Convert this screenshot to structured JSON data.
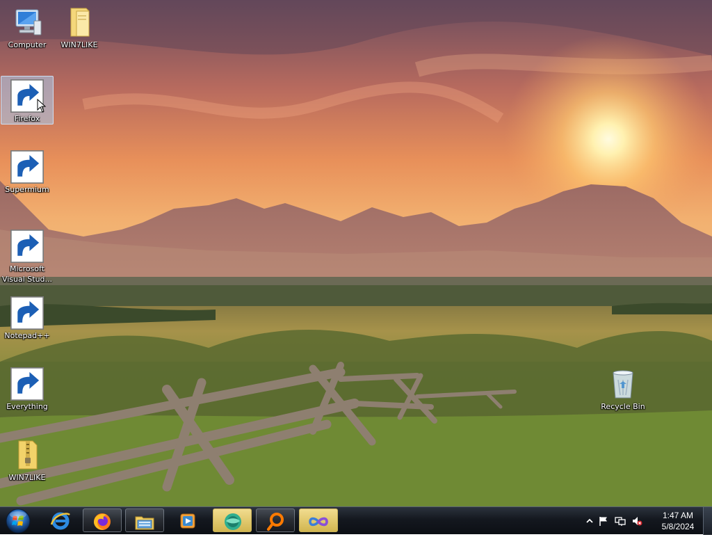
{
  "desktop": {
    "icons": [
      {
        "name": "computer",
        "label": "Computer",
        "icon": "computer-icon",
        "shortcut": false
      },
      {
        "name": "win7like-folder-top",
        "label": "WIN7LIKE",
        "icon": "folder-icon",
        "shortcut": false
      },
      {
        "name": "firefox",
        "label": "Firefox",
        "icon": "firefox-icon",
        "shortcut": true,
        "selected": true
      },
      {
        "name": "supermium",
        "label": "Supermium",
        "icon": "supermium-icon",
        "shortcut": true
      },
      {
        "name": "visual-studio",
        "label": "Microsoft\nVisual Stud...",
        "icon": "visual-studio-icon",
        "shortcut": true
      },
      {
        "name": "notepadpp",
        "label": "Notepad++",
        "icon": "notepadpp-icon",
        "shortcut": true
      },
      {
        "name": "everything",
        "label": "Everything",
        "icon": "everything-icon",
        "shortcut": true
      },
      {
        "name": "win7like-zip",
        "label": "WIN7LIKE",
        "icon": "zip-folder-icon",
        "shortcut": false
      },
      {
        "name": "recycle-bin",
        "label": "Recycle Bin",
        "icon": "recycle-bin-icon",
        "shortcut": false
      }
    ]
  },
  "taskbar": {
    "start": "start-orb-icon",
    "buttons": [
      {
        "name": "internet-explorer",
        "icon": "internet-explorer-icon",
        "state": "pinned"
      },
      {
        "name": "firefox",
        "icon": "firefox-icon",
        "state": "open"
      },
      {
        "name": "explorer",
        "icon": "explorer-folder-icon",
        "state": "open"
      },
      {
        "name": "media-player",
        "icon": "media-player-icon",
        "state": "pinned"
      },
      {
        "name": "supermium",
        "icon": "supermium-icon",
        "state": "active"
      },
      {
        "name": "everything",
        "icon": "everything-icon",
        "state": "open"
      },
      {
        "name": "visual-studio",
        "icon": "visual-studio-icon",
        "state": "active"
      }
    ],
    "tray": {
      "icons": [
        "show-hidden-icons-chevron-icon",
        "action-center-flag-icon",
        "network-icon",
        "volume-muted-icon"
      ],
      "time": "1:47 AM",
      "date": "5/8/2024"
    }
  },
  "colors": {
    "taskbar": "#14181f",
    "selection": "#aacdf0",
    "active_button": "#e6cd74"
  }
}
